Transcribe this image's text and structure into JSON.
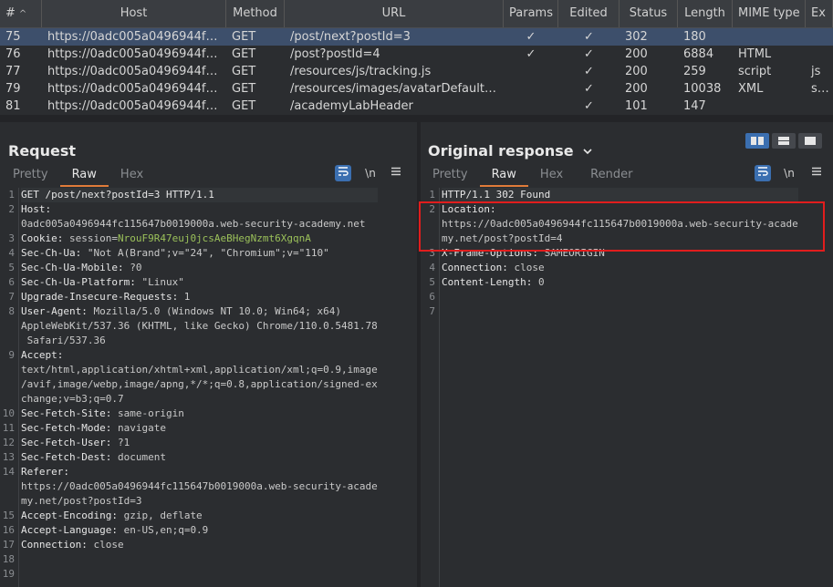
{
  "history": {
    "columns": [
      "#",
      "Host",
      "Method",
      "URL",
      "Params",
      "Edited",
      "Status",
      "Length",
      "MIME type",
      "Ex"
    ],
    "rows": [
      {
        "num": "75",
        "host": "https://0adc005a0496944fc...",
        "method": "GET",
        "url": "/post/next?postId=3",
        "params": "✓",
        "edited": "✓",
        "status": "302",
        "length": "180",
        "mime": "",
        "ext": ""
      },
      {
        "num": "76",
        "host": "https://0adc005a0496944fc...",
        "method": "GET",
        "url": "/post?postId=4",
        "params": "✓",
        "edited": "✓",
        "status": "200",
        "length": "6884",
        "mime": "HTML",
        "ext": ""
      },
      {
        "num": "77",
        "host": "https://0adc005a0496944fc...",
        "method": "GET",
        "url": "/resources/js/tracking.js",
        "params": "",
        "edited": "✓",
        "status": "200",
        "length": "259",
        "mime": "script",
        "ext": "js"
      },
      {
        "num": "79",
        "host": "https://0adc005a0496944fc...",
        "method": "GET",
        "url": "/resources/images/avatarDefault.svg",
        "params": "",
        "edited": "✓",
        "status": "200",
        "length": "10038",
        "mime": "XML",
        "ext": "svg"
      },
      {
        "num": "81",
        "host": "https://0adc005a0496944fc...",
        "method": "GET",
        "url": "/academyLabHeader",
        "params": "",
        "edited": "✓",
        "status": "101",
        "length": "147",
        "mime": "",
        "ext": ""
      }
    ]
  },
  "request": {
    "title": "Request",
    "tabs": [
      "Pretty",
      "Raw",
      "Hex"
    ],
    "active_tab": "Raw",
    "line_numbers": [
      "1",
      "2",
      "3",
      "4",
      "5",
      "6",
      "7",
      "8",
      "9",
      "10",
      "11",
      "12",
      "13",
      "14",
      "15",
      "16",
      "17",
      "18",
      "19"
    ],
    "lines": [
      {
        "num": "1",
        "key": "GET /post/next?postId=3 HTTP/1.1",
        "val": ""
      },
      {
        "num": "2",
        "key": "Host:",
        "val": ""
      },
      {
        "num": "",
        "key": "",
        "val": "0adc005a0496944fc115647b0019000a.web-security-academy.net"
      },
      {
        "num": "3",
        "key": "Cookie:",
        "val": " session=",
        "cookie": "NrouF9R47euj0jcsAeBHegNzmt6XgqnA"
      },
      {
        "num": "4",
        "key": "Sec-Ch-Ua:",
        "val": " \"Not A(Brand\";v=\"24\", \"Chromium\";v=\"110\""
      },
      {
        "num": "5",
        "key": "Sec-Ch-Ua-Mobile:",
        "val": " ?0"
      },
      {
        "num": "6",
        "key": "Sec-Ch-Ua-Platform:",
        "val": " \"Linux\""
      },
      {
        "num": "7",
        "key": "Upgrade-Insecure-Requests:",
        "val": " 1"
      },
      {
        "num": "8",
        "key": "User-Agent:",
        "val": " Mozilla/5.0 (Windows NT 10.0; Win64; x64)"
      },
      {
        "num": "",
        "key": "",
        "val": "AppleWebKit/537.36 (KHTML, like Gecko) Chrome/110.0.5481.78"
      },
      {
        "num": "",
        "key": "",
        "val": " Safari/537.36"
      },
      {
        "num": "9",
        "key": "Accept:",
        "val": ""
      },
      {
        "num": "",
        "key": "",
        "val": "text/html,application/xhtml+xml,application/xml;q=0.9,image"
      },
      {
        "num": "",
        "key": "",
        "val": "/avif,image/webp,image/apng,*/*;q=0.8,application/signed-ex"
      },
      {
        "num": "",
        "key": "",
        "val": "change;v=b3;q=0.7"
      },
      {
        "num": "10",
        "key": "Sec-Fetch-Site:",
        "val": " same-origin"
      },
      {
        "num": "11",
        "key": "Sec-Fetch-Mode:",
        "val": " navigate"
      },
      {
        "num": "12",
        "key": "Sec-Fetch-User:",
        "val": " ?1"
      },
      {
        "num": "13",
        "key": "Sec-Fetch-Dest:",
        "val": " document"
      },
      {
        "num": "14",
        "key": "Referer:",
        "val": ""
      },
      {
        "num": "",
        "key": "",
        "val": "https://0adc005a0496944fc115647b0019000a.web-security-acade"
      },
      {
        "num": "",
        "key": "",
        "val": "my.net/post?postId=3"
      },
      {
        "num": "15",
        "key": "Accept-Encoding:",
        "val": " gzip, deflate"
      },
      {
        "num": "16",
        "key": "Accept-Language:",
        "val": " en-US,en;q=0.9"
      },
      {
        "num": "17",
        "key": "Connection:",
        "val": " close"
      },
      {
        "num": "18",
        "key": "",
        "val": ""
      },
      {
        "num": "19",
        "key": "",
        "val": ""
      }
    ]
  },
  "response": {
    "title": "Original response",
    "tabs": [
      "Pretty",
      "Raw",
      "Hex",
      "Render"
    ],
    "active_tab": "Raw",
    "lines": [
      {
        "num": "1",
        "key": "HTTP/1.1 302 Found",
        "val": ""
      },
      {
        "num": "2",
        "key": "Location:",
        "val": ""
      },
      {
        "num": "",
        "key": "",
        "val": "https://0adc005a0496944fc115647b0019000a.web-security-acade"
      },
      {
        "num": "",
        "key": "",
        "val": "my.net/post?postId=4"
      },
      {
        "num": "3",
        "key": "X-Frame-Options:",
        "val": " SAMEORIGIN"
      },
      {
        "num": "4",
        "key": "Connection:",
        "val": " close"
      },
      {
        "num": "5",
        "key": "Content-Length:",
        "val": " 0"
      },
      {
        "num": "6",
        "key": "",
        "val": ""
      },
      {
        "num": "7",
        "key": "",
        "val": ""
      }
    ]
  },
  "toolbar": {
    "wrap_icon": "wrap-lines-icon",
    "newline_label": "\\n",
    "menu_icon": "hamburger-menu-icon"
  },
  "colors": {
    "accent": "#e07b39",
    "selection": "#3d4f6b",
    "highlight_box": "#e11d1d",
    "cookie_value": "#9bc15a",
    "toggle_blue": "#3b6fb0"
  }
}
